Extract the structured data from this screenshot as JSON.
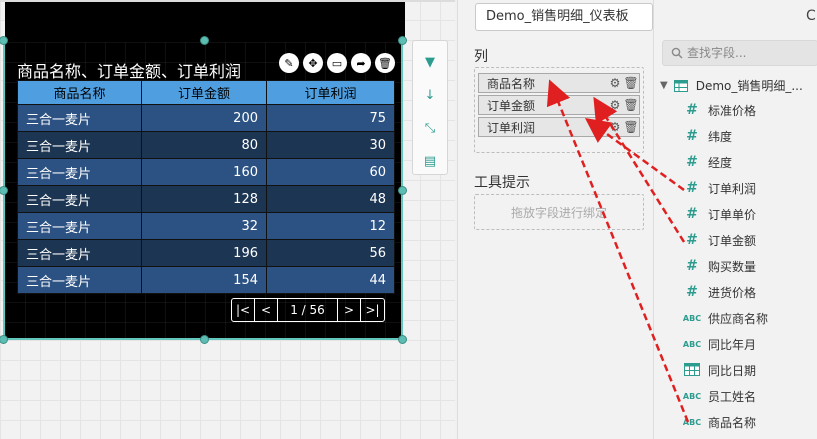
{
  "widget": {
    "title": "商品名称、订单金额、订单利润",
    "tools": [
      "✎",
      "✥",
      "▭",
      "➦",
      "🗑"
    ],
    "columns": [
      "商品名称",
      "订单金额",
      "订单利润"
    ],
    "rows": [
      [
        "三合一麦片",
        "200",
        "75"
      ],
      [
        "三合一麦片",
        "80",
        "30"
      ],
      [
        "三合一麦片",
        "160",
        "60"
      ],
      [
        "三合一麦片",
        "128",
        "48"
      ],
      [
        "三合一麦片",
        "32",
        "12"
      ],
      [
        "三合一麦片",
        "196",
        "56"
      ],
      [
        "三合一麦片",
        "154",
        "44"
      ]
    ],
    "pager": {
      "first": "|<",
      "prev": "<",
      "info": "1 / 56",
      "next": ">",
      "last": ">|"
    }
  },
  "side_tools": {
    "filter": "▼",
    "sort": "↓",
    "collapse": "⤡",
    "card": "▤"
  },
  "binding": {
    "datasource": "Demo_销售明细_仪表板",
    "columns_title": "列",
    "column_items": [
      "商品名称",
      "订单金额",
      "订单利润"
    ],
    "gear": "⚙",
    "trash": "🗑",
    "tooltip_title": "工具提示",
    "tooltip_drop": "拖放字段进行绑定"
  },
  "fields": {
    "refresh": "C",
    "search_placeholder": "查找字段...",
    "root": "Demo_销售明细_...",
    "items": [
      {
        "type": "#",
        "name": "标准价格"
      },
      {
        "type": "#",
        "name": "纬度"
      },
      {
        "type": "#",
        "name": "经度"
      },
      {
        "type": "#",
        "name": "订单利润"
      },
      {
        "type": "#",
        "name": "订单单价"
      },
      {
        "type": "#",
        "name": "订单金额"
      },
      {
        "type": "#",
        "name": "购买数量"
      },
      {
        "type": "#",
        "name": "进货价格"
      },
      {
        "type": "ABC",
        "name": "供应商名称"
      },
      {
        "type": "ABC",
        "name": "同比年月"
      },
      {
        "type": "date",
        "name": "同比日期"
      },
      {
        "type": "ABC",
        "name": "员工姓名"
      },
      {
        "type": "ABC",
        "name": "商品名称"
      }
    ]
  },
  "colors": {
    "accent": "#2c9c8f",
    "header": "#4f9fe0",
    "row_odd": "#2c5283",
    "row_even": "#1c3552",
    "arrow": "#e02020"
  }
}
